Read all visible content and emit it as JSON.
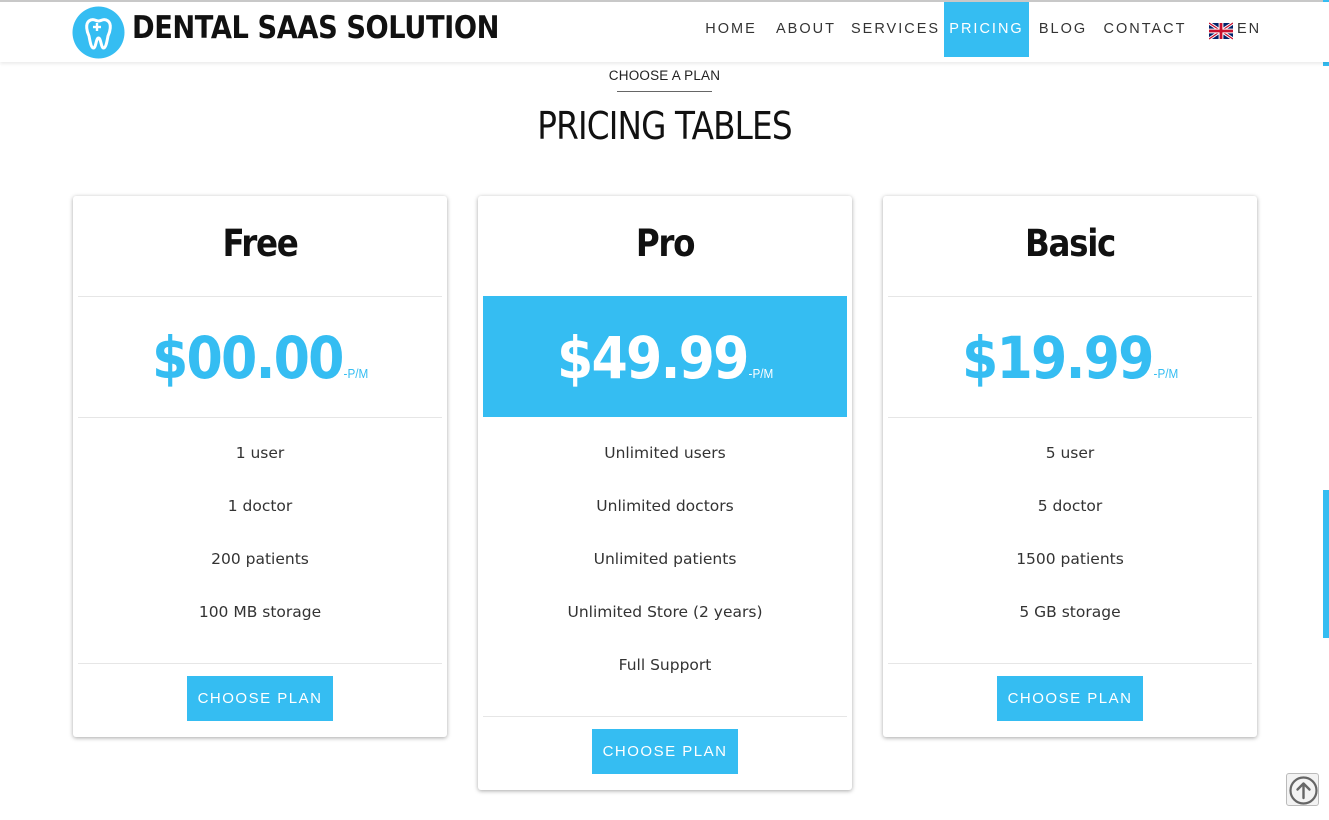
{
  "header": {
    "brand": "DENTAL SAAS SOLUTION",
    "nav": [
      {
        "label": "HOME",
        "active": false
      },
      {
        "label": "ABOUT",
        "active": false
      },
      {
        "label": "SERVICES",
        "active": false
      },
      {
        "label": "PRICING",
        "active": true
      },
      {
        "label": "BLOG",
        "active": false
      },
      {
        "label": "CONTACT",
        "active": false
      }
    ],
    "language": "EN",
    "language_icon": "uk-flag-icon"
  },
  "section": {
    "eyebrow": "CHOOSE A PLAN",
    "title": "PRICING TABLES"
  },
  "plans": [
    {
      "name": "Free",
      "price": "$00.00",
      "period": "-P/M",
      "highlighted": false,
      "features": [
        "1 user",
        "1 doctor",
        "200 patients",
        "100 MB storage"
      ],
      "button": "CHOOSE PLAN"
    },
    {
      "name": "Pro",
      "price": "$49.99",
      "period": "-P/M",
      "highlighted": true,
      "features": [
        "Unlimited users",
        "Unlimited doctors",
        "Unlimited patients",
        "Unlimited Store (2 years)",
        "Full Support"
      ],
      "button": "CHOOSE PLAN"
    },
    {
      "name": "Basic",
      "price": "$19.99",
      "period": "-P/M",
      "highlighted": false,
      "features": [
        "5 user",
        "5 doctor",
        "1500 patients",
        "5 GB storage"
      ],
      "button": "CHOOSE PLAN"
    }
  ],
  "colors": {
    "accent": "#35bdf2",
    "text": "#222222"
  },
  "icons": {
    "logo": "tooth-plus-icon",
    "scroll_top": "arrow-up-circle-icon"
  }
}
